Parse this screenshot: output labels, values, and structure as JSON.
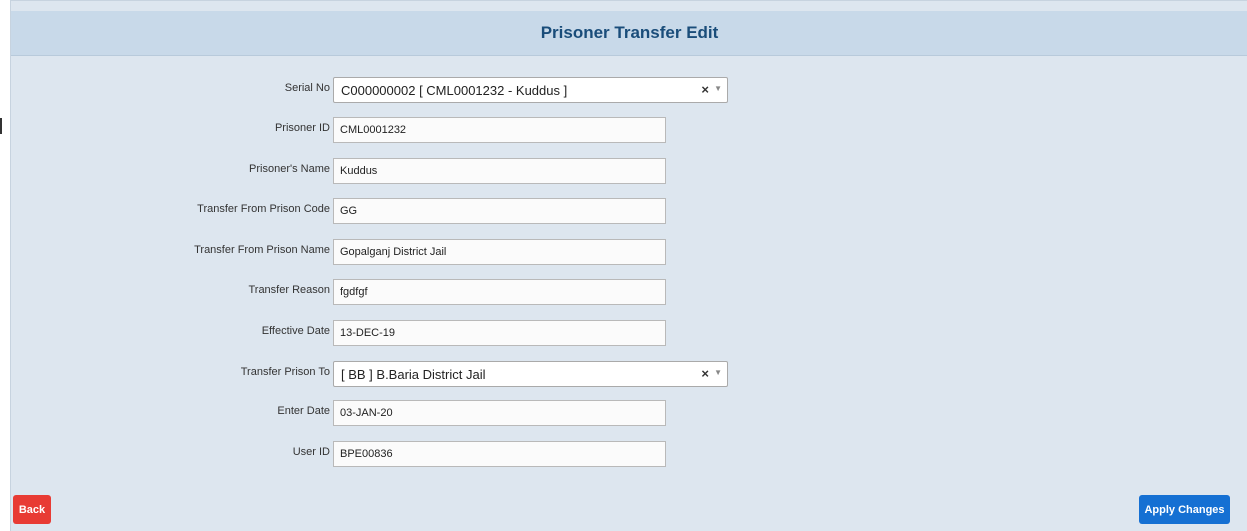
{
  "page": {
    "title": "Prisoner Transfer Edit"
  },
  "form": {
    "serial_no": {
      "label": "Serial No",
      "value": "C000000002 [ CML0001232 - Kuddus ]",
      "clear": "×",
      "arrow": "▼"
    },
    "prisoner_id": {
      "label": "Prisoner ID",
      "value": "CML0001232"
    },
    "prisoner_name": {
      "label": "Prisoner's Name",
      "value": "Kuddus"
    },
    "transfer_from_code": {
      "label": "Transfer From Prison Code",
      "value": "GG"
    },
    "transfer_from_name": {
      "label": "Transfer From Prison Name",
      "value": "Gopalganj District Jail"
    },
    "transfer_reason": {
      "label": "Transfer Reason",
      "value": "fgdfgf"
    },
    "effective_date": {
      "label": "Effective Date",
      "value": "13-DEC-19"
    },
    "transfer_prison_to": {
      "label": "Transfer Prison To",
      "value": "[ BB ] B.Baria District Jail",
      "clear": "×",
      "arrow": "▼"
    },
    "enter_date": {
      "label": "Enter Date",
      "value": "03-JAN-20"
    },
    "user_id": {
      "label": "User ID",
      "value": "BPE00836"
    }
  },
  "actions": {
    "back_label": "Back",
    "apply_label": "Apply Changes"
  },
  "colors": {
    "header_text": "#1a4d7a",
    "panel_bg": "#dde6ef",
    "header_bg": "#c8d9e9",
    "back_button": "#e83b34",
    "apply_button": "#1570d3"
  }
}
